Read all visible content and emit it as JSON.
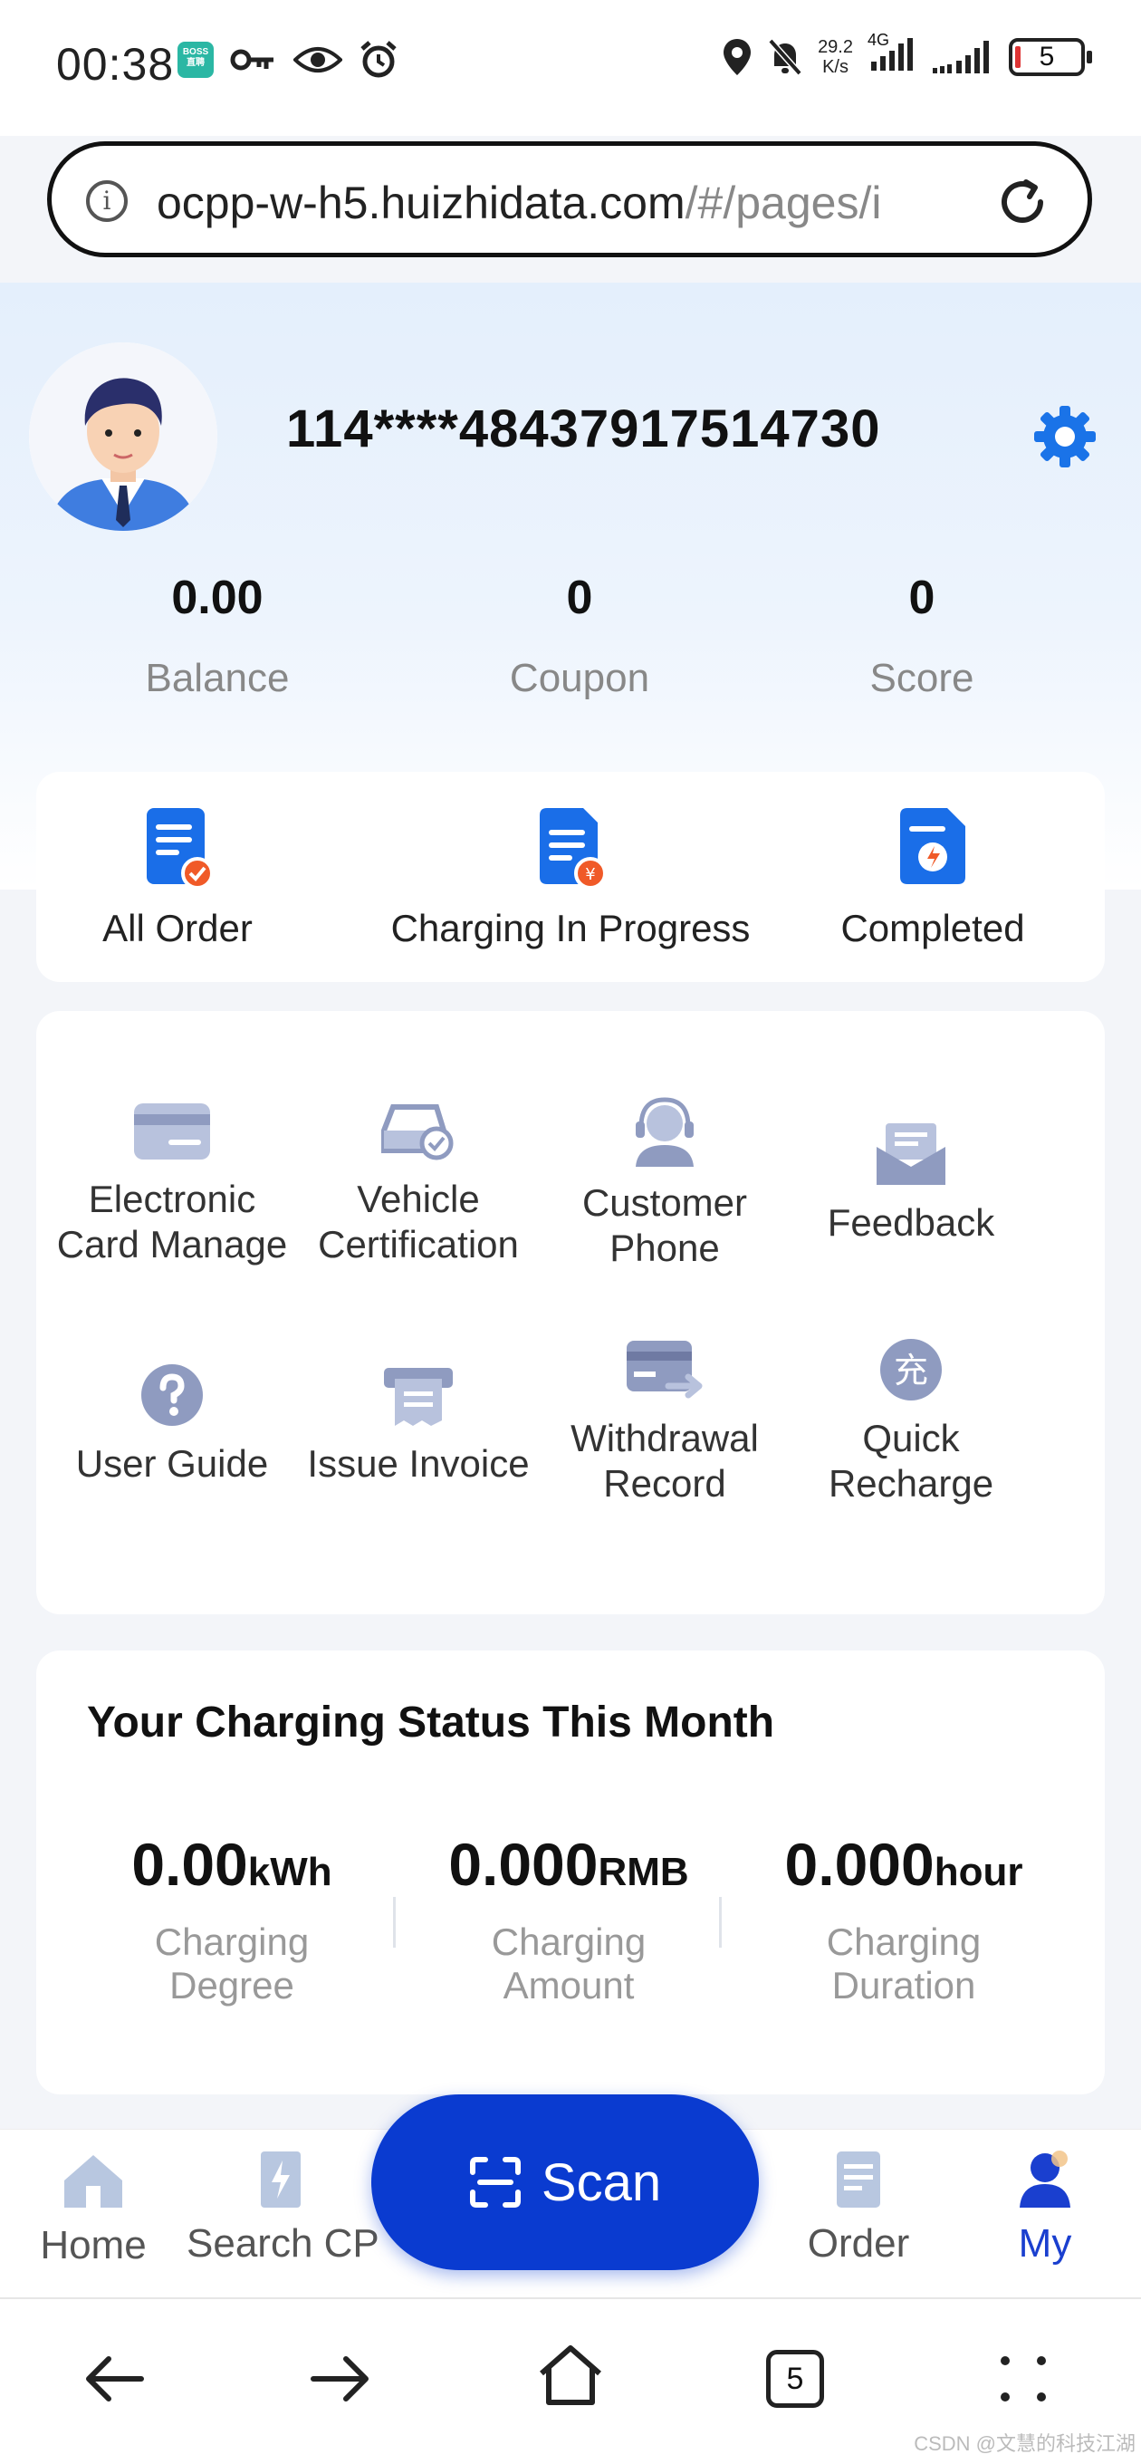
{
  "status_bar": {
    "time": "00:38",
    "boss_badge_line1": "BOSS",
    "boss_badge_line2": "直聘",
    "speed_value": "29.2",
    "speed_unit": "K/s",
    "network": "4G",
    "battery": "5"
  },
  "browser": {
    "url_host": "ocpp-w-h5.huizhidata.com",
    "url_path": "/#/pages/i",
    "tabs_count": "5"
  },
  "profile": {
    "user_id": "114****48437917514730",
    "stats": [
      {
        "value": "0.00",
        "label": "Balance"
      },
      {
        "value": "0",
        "label": "Coupon"
      },
      {
        "value": "0",
        "label": "Score"
      }
    ]
  },
  "orders": [
    {
      "label": "All Order",
      "icon": "all-order-icon"
    },
    {
      "label": "Charging In Progress",
      "icon": "charging-in-progress-icon"
    },
    {
      "label": "Completed",
      "icon": "completed-icon"
    }
  ],
  "services": [
    {
      "line1": "Electronic",
      "line2": "Card Manage",
      "icon": "card-icon"
    },
    {
      "line1": "Vehicle",
      "line2": "Certification",
      "icon": "vehicle-icon"
    },
    {
      "line1": "Customer",
      "line2": "Phone",
      "icon": "headset-icon"
    },
    {
      "line1": "Feedback",
      "line2": "",
      "icon": "envelope-icon"
    },
    {
      "line1": "User Guide",
      "line2": "",
      "icon": "question-icon"
    },
    {
      "line1": "Issue Invoice",
      "line2": "",
      "icon": "invoice-icon"
    },
    {
      "line1": "Withdrawal",
      "line2": "Record",
      "icon": "withdrawal-icon"
    },
    {
      "line1": "Quick",
      "line2": "Recharge",
      "icon": "recharge-icon"
    }
  ],
  "month_status": {
    "title": "Your Charging Status This Month",
    "items": [
      {
        "value": "0.00",
        "unit": "kWh",
        "line1": "Charging",
        "line2": "Degree"
      },
      {
        "value": "0.000",
        "unit": "RMB",
        "line1": "Charging",
        "line2": "Amount"
      },
      {
        "value": "0.000",
        "unit": "hour",
        "line1": "Charging",
        "line2": "Duration"
      }
    ]
  },
  "recharge_glyph": "充",
  "tab_bar": {
    "home": "Home",
    "search": "Search CP",
    "scan": "Scan",
    "order": "Order",
    "my": "My"
  },
  "watermark": "CSDN @文慧的科技江湖",
  "colors": {
    "primary": "#0a3bd0",
    "settings_blue": "#1a73e8",
    "order_icon_blue": "#1a6ee8",
    "service_icon_grey": "#9aa3bf",
    "badge_orange": "#f05a28"
  }
}
